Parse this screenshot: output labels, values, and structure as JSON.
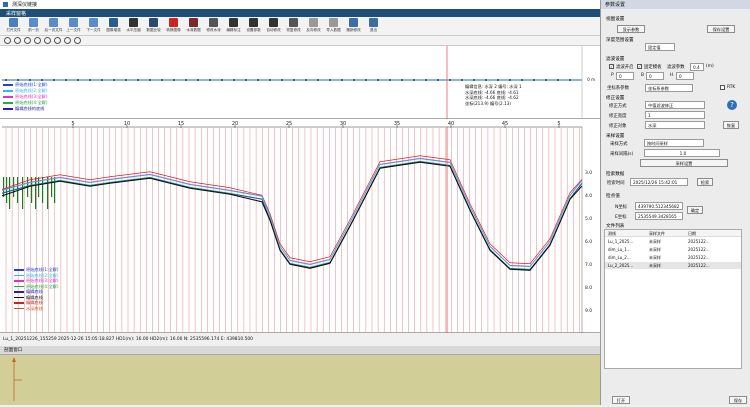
{
  "window": {
    "title": "测深仪链接"
  },
  "app_tab": "采样窗格",
  "toolbar": [
    {
      "label": "打开文件",
      "color": "#4a7fbf"
    },
    {
      "label": "前一页",
      "color": "#5b8bc9"
    },
    {
      "label": "后一页文件",
      "color": "#5b8bc9"
    },
    {
      "label": "上一文件",
      "color": "#5b8bc9"
    },
    {
      "label": "下一文件",
      "color": "#5b8bc9"
    },
    {
      "label": "图像增强",
      "color": "#2c5b8c"
    },
    {
      "label": "水平压缩",
      "color": "#333333"
    },
    {
      "label": "数据比较",
      "color": "#2c4a70"
    },
    {
      "label": "转换图像",
      "color": "#cc2222"
    },
    {
      "label": "水深数据",
      "color": "#7a2a2a"
    },
    {
      "label": "修改水深",
      "color": "#555555"
    },
    {
      "label": "编辑标注",
      "color": "#333333"
    },
    {
      "label": "设置参数",
      "color": "#333333"
    },
    {
      "label": "自动修改",
      "color": "#333333"
    },
    {
      "label": "恢复修改",
      "color": "#555555"
    },
    {
      "label": "反向修改",
      "color": "#999999"
    },
    {
      "label": "导入数据",
      "color": "#999999"
    },
    {
      "label": "撤销修改",
      "color": "#3a6ea5"
    },
    {
      "label": "退出",
      "color": "#3a6ea5"
    }
  ],
  "upper_legend": [
    {
      "label": "原始底线(1:全解)",
      "color": "#2244cc"
    },
    {
      "label": "原始底线(2:全解)",
      "color": "#33bbdd"
    },
    {
      "label": "原始底线(3:全解)",
      "color": "#dd33cc"
    },
    {
      "label": "原始底线(4:全解)",
      "color": "#22aa44"
    },
    {
      "label": "编辑底线的底线",
      "color": "#2222aa"
    }
  ],
  "upper_info": {
    "line1": "编辑信息: 水深 2 编号: 水深 1",
    "line2": "水深底线: -4.66 底线: -4.61",
    "line3": "水深底线: -4.66 底线: -4.62",
    "line4": "坐标(213.9) 编号(2.13)"
  },
  "xaxis_ticks": [
    "5",
    "10",
    "15",
    "20",
    "25",
    "30",
    "35",
    "40",
    "45",
    "5"
  ],
  "left_axis_upper": [
    "0 m"
  ],
  "right_axis_labels": [
    "3.0",
    "4.0",
    "5.0",
    "6.0",
    "7.0",
    "8.0",
    "9.0"
  ],
  "lower_legend": [
    {
      "label": "原始底线(1:全解)",
      "color": "#2244cc"
    },
    {
      "label": "原始底线(2:全解)",
      "color": "#33bbdd"
    },
    {
      "label": "原始底线(3:全解)",
      "color": "#dd33cc"
    },
    {
      "label": "原始底线(4:全解)",
      "color": "#22aa44"
    },
    {
      "label": "编辑底线",
      "color": "#2222aa"
    },
    {
      "label": "编辑底线",
      "color": "#111111"
    },
    {
      "label": "编辑底线",
      "color": "#cc2222"
    },
    {
      "label": "水深底线",
      "color": "#cc5522"
    }
  ],
  "status": "Lu_1_20251226_155259 2025-12-26 15:05:18.827  HD1(m): 16.00  HD2(m): 16.00  N: 2535596.174  E: 439810.500",
  "subwindow_title": "剖面窗口",
  "right_panel": {
    "title": "参数设置",
    "section_display": "视图设置",
    "btn_display": "显示参数",
    "btn_reset": "保存设置",
    "section_range": "深度范围设置",
    "range_value": "固定值",
    "section_filter": "滤波设置",
    "chk_filter": "滤波开启",
    "chk_auto": "固定模板",
    "filter_step_label": "滤波参数",
    "filter_step_value": "0.4",
    "unit": "(m)",
    "p_label": "P",
    "p_value": "0",
    "b_label": "B",
    "b_value": "0",
    "h_label": "H",
    "h_value": "0",
    "coord_label": "坐标系参数",
    "coord_value": "坐标系参数",
    "rtk_label": "RTK",
    "section_wave": "修正设置",
    "wave_mode_label": "修正方式",
    "wave_mode_value": "中值滤波修正",
    "wave_width_label": "修正宽度",
    "wave_width_value": "1",
    "wave_obj_label": "修正对象",
    "wave_obj_value": "水深",
    "btn_revert": "恢复",
    "section_sample": "采样设置",
    "sample_mode_label": "采样方式",
    "sample_mode_value": "按时间采样",
    "sample_interval_label": "采样间隔(s)",
    "sample_interval_value": "1.0",
    "btn_sample": "采样设置",
    "section_time": "检索数据",
    "time_label": "检索时间",
    "time_value": "2025/12/26 15:42:01",
    "btn_search": "检索",
    "section_coord": "检点值",
    "n_label": "N坐标",
    "n_value": "439790.512345682",
    "e_label": "E坐标",
    "e_value": "2535549.3428165",
    "btn_confirm": "确定",
    "section_files": "文件列表",
    "file_headers": [
      "测线",
      "采样文件",
      "日期"
    ],
    "files": [
      [
        "Lu_1_2025...",
        "未采样",
        "2025122..."
      ],
      [
        "dim_Lu_1...",
        "未采样",
        "2025122..."
      ],
      [
        "dim_Lu_2...",
        "未采样",
        "2025122..."
      ],
      [
        "Lu_2_2025...",
        "未采样",
        "2025122..."
      ]
    ],
    "btn_open": "打开",
    "btn_save": "保存"
  }
}
